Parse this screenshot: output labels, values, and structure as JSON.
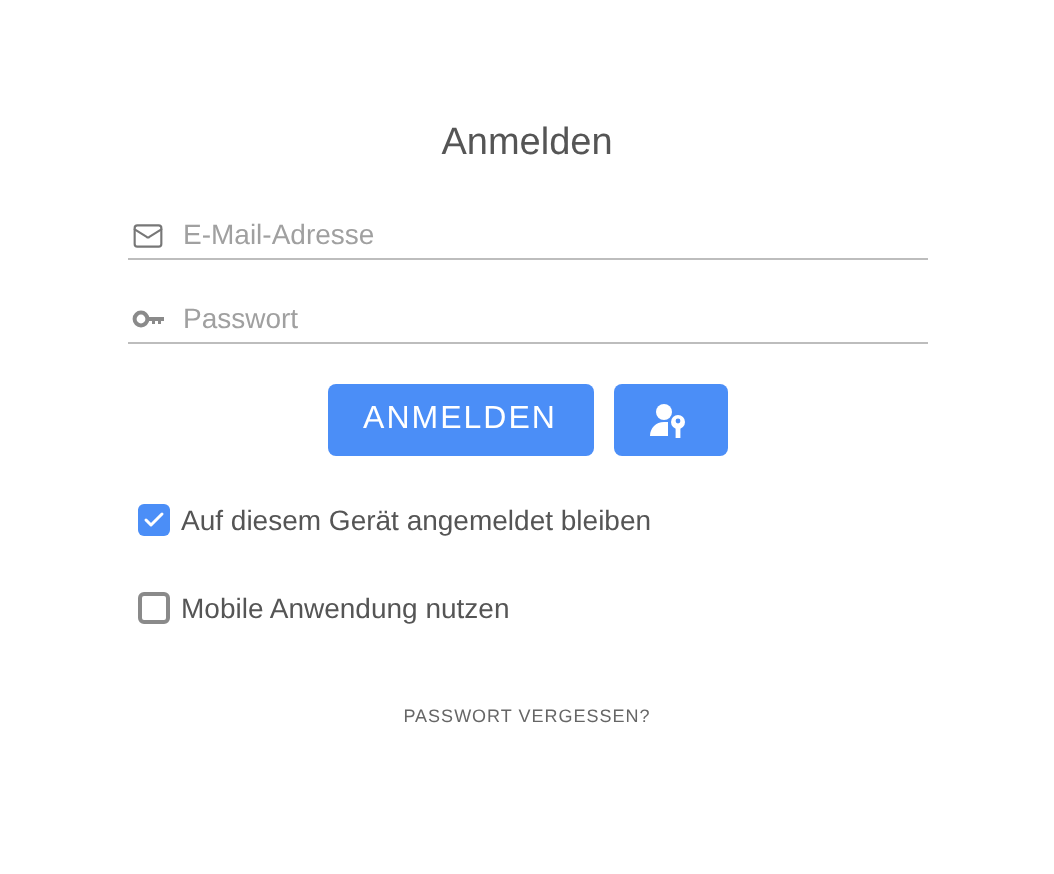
{
  "title": "Anmelden",
  "fields": [
    {
      "kind": "email",
      "placeholder": "E-Mail-Adresse"
    },
    {
      "kind": "password",
      "placeholder": "Passwort"
    }
  ],
  "login_button": "ANMELDEN",
  "options": [
    {
      "label": "Auf diesem Gerät angemeldet bleiben",
      "checked": true
    },
    {
      "label": "Mobile Anwendung nutzen",
      "checked": false
    }
  ],
  "forgot_link": "PASSWORT VERGESSEN?"
}
